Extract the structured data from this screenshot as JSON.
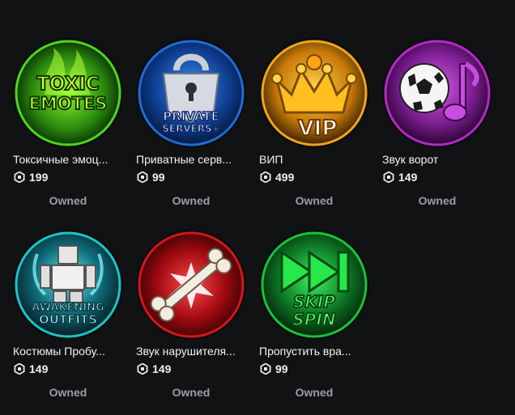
{
  "items": [
    {
      "name": "Токсичные эмоц...",
      "price": "199",
      "status": "Owned",
      "icon": "toxic-emotes-icon",
      "icon_text": [
        "TOXIC",
        "EMOTES"
      ],
      "colors": {
        "ring": "#4fd61a",
        "bg": "#1d5c0e"
      }
    },
    {
      "name": "Приватные серв...",
      "price": "99",
      "status": "Owned",
      "icon": "private-servers-icon",
      "icon_text": [
        "PRIVATE",
        "SERVERS+"
      ],
      "colors": {
        "ring": "#1e6cd8",
        "bg": "#0a2a6b"
      }
    },
    {
      "name": "ВИП",
      "price": "499",
      "status": "Owned",
      "icon": "vip-crown-icon",
      "icon_text": [
        "VIP"
      ],
      "colors": {
        "ring": "#f0a51a",
        "bg": "#7a4a05"
      }
    },
    {
      "name": "Звук ворот",
      "price": "149",
      "status": "Owned",
      "icon": "goal-sound-icon",
      "icon_text": [],
      "colors": {
        "ring": "#b627c9",
        "bg": "#4b0e5a"
      }
    },
    {
      "name": "Костюмы Пробу...",
      "price": "149",
      "status": "Owned",
      "icon": "awakening-outfits-icon",
      "icon_text": [
        "AWAKENING",
        "OUTFITS"
      ],
      "colors": {
        "ring": "#1ac4c9",
        "bg": "#0b3f4a"
      }
    },
    {
      "name": "Звук нарушителя...",
      "price": "149",
      "status": "Owned",
      "icon": "foul-sound-bone-icon",
      "icon_text": [],
      "colors": {
        "ring": "#d3161d",
        "bg": "#5a0609"
      }
    },
    {
      "name": "Пропустить вра...",
      "price": "99",
      "status": "Owned",
      "icon": "skip-spin-icon",
      "icon_text": [
        "SKIP",
        "SPIN"
      ],
      "colors": {
        "ring": "#17c23a",
        "bg": "#08461a"
      }
    }
  ],
  "currency_icon": "robux-icon"
}
